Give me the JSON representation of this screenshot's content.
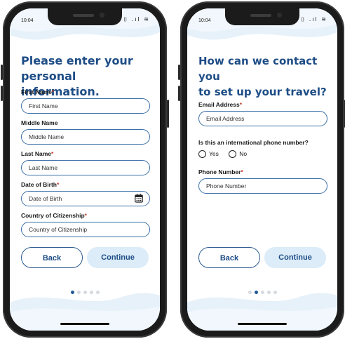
{
  "status": {
    "time": "10:04",
    "icons": "⌷ .ıl ≋"
  },
  "screen1": {
    "title_line1": "Please enter your",
    "title_line2": "personal information.",
    "fields": [
      {
        "label": "First Name",
        "required": "*",
        "placeholder": "First Name"
      },
      {
        "label": "Middle Name",
        "required": "",
        "placeholder": "Middle Name"
      },
      {
        "label": "Last Name",
        "required": "*",
        "placeholder": "Last Name"
      },
      {
        "label": "Date of Birth",
        "required": "*",
        "placeholder": "Date of Birth"
      },
      {
        "label": "Country of Citizenship",
        "required": "*",
        "placeholder": "Country of Citizenship"
      }
    ],
    "back_label": "Back",
    "continue_label": "Continue",
    "page_index": 1,
    "page_count": 5
  },
  "screen2": {
    "title_line1": "How can we contact you",
    "title_line2": "to set up your travel?",
    "email": {
      "label": "Email Address",
      "required": "*",
      "placeholder": "Email Address"
    },
    "intl_question": "Is this an international phone number?",
    "radio_yes": "Yes",
    "radio_no": "No",
    "phone": {
      "label": "Phone Number",
      "required": "*",
      "placeholder": "Phone Number"
    },
    "back_label": "Back",
    "continue_label": "Continue",
    "page_index": 2,
    "page_count": 5
  },
  "colors": {
    "accent": "#1e4d86",
    "continue_bg": "#dcecf8",
    "required": "#c0392b",
    "wave": "#e6f1fa"
  }
}
